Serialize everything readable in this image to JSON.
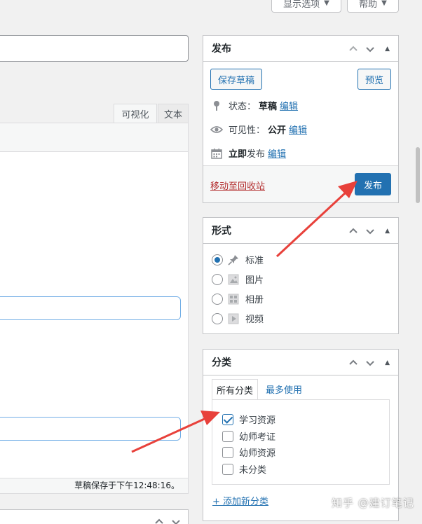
{
  "topbar": {
    "screen_options": "显示选项",
    "help": "帮助"
  },
  "editor": {
    "tab_visual": "可视化",
    "tab_text": "文本",
    "status": "草稿保存于下午12:48:16。"
  },
  "publish": {
    "title": "发布",
    "save_draft": "保存草稿",
    "preview": "预览",
    "status_label": "状态：",
    "status_value": "草稿",
    "visibility_label": "可见性：",
    "visibility_value": "公开",
    "schedule_bold": "立即",
    "schedule_label": "发布",
    "edit": "编辑",
    "trash": "移动至回收站",
    "publish_button": "发布"
  },
  "format": {
    "title": "形式",
    "options": [
      {
        "label": "标准",
        "icon": "pushpin-icon",
        "selected": true
      },
      {
        "label": "图片",
        "icon": "image-icon",
        "selected": false
      },
      {
        "label": "相册",
        "icon": "gallery-icon",
        "selected": false
      },
      {
        "label": "视频",
        "icon": "video-icon",
        "selected": false
      }
    ]
  },
  "categories": {
    "title": "分类",
    "tab_all": "所有分类",
    "tab_popular": "最多使用",
    "items": [
      {
        "label": "学习资源",
        "checked": true
      },
      {
        "label": "幼师考证",
        "checked": false
      },
      {
        "label": "幼师资源",
        "checked": false
      },
      {
        "label": "未分类",
        "checked": false
      }
    ],
    "add_new": "+ 添加新分类"
  },
  "watermark": "知乎 @建订笔记",
  "colors": {
    "accent": "#2271b1",
    "annotation_arrow": "#e8413b",
    "trash_link": "#b32d2e"
  }
}
